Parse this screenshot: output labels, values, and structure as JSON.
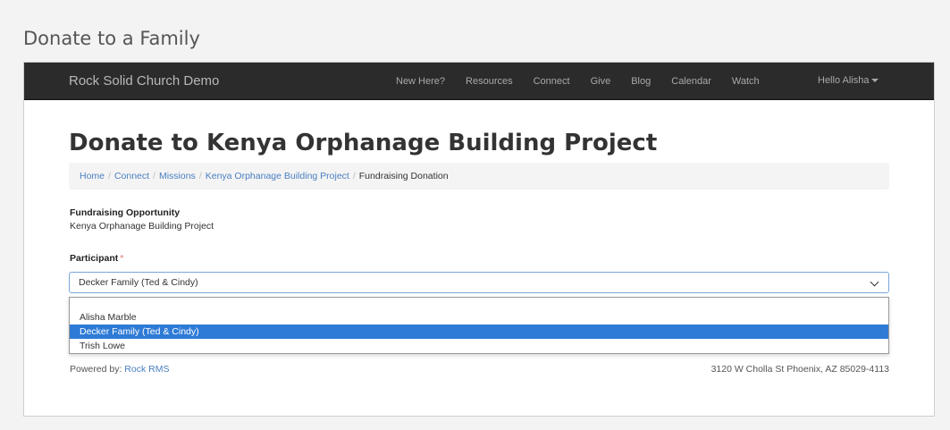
{
  "outer_title": "Donate to a Family",
  "navbar": {
    "brand": "Rock Solid Church Demo",
    "links": [
      "New Here?",
      "Resources",
      "Connect",
      "Give",
      "Blog",
      "Calendar",
      "Watch"
    ],
    "user": "Hello Alisha"
  },
  "page_title": "Donate to Kenya Orphanage Building Project",
  "breadcrumb": {
    "links": [
      "Home",
      "Connect",
      "Missions",
      "Kenya Orphanage Building Project"
    ],
    "separator": "/",
    "active": "Fundraising Donation"
  },
  "fundraising": {
    "label": "Fundraising Opportunity",
    "value": "Kenya Orphanage Building Project"
  },
  "participant": {
    "label": "Participant",
    "required_marker": "*",
    "selected": "Decker Family (Ted & Cindy)",
    "options": [
      "Alisha Marble",
      "Decker Family (Ted & Cindy)",
      "Trish Lowe"
    ]
  },
  "footer": {
    "powered_prefix": "Powered by:",
    "powered_link": "Rock RMS",
    "address": "3120 W Cholla St Phoenix, AZ 85029-4113"
  },
  "colors": {
    "navbar_bg": "#2b2b2b",
    "link": "#4a7fc1",
    "selected_option": "#2e7bd6",
    "required": "#e89a9a"
  }
}
